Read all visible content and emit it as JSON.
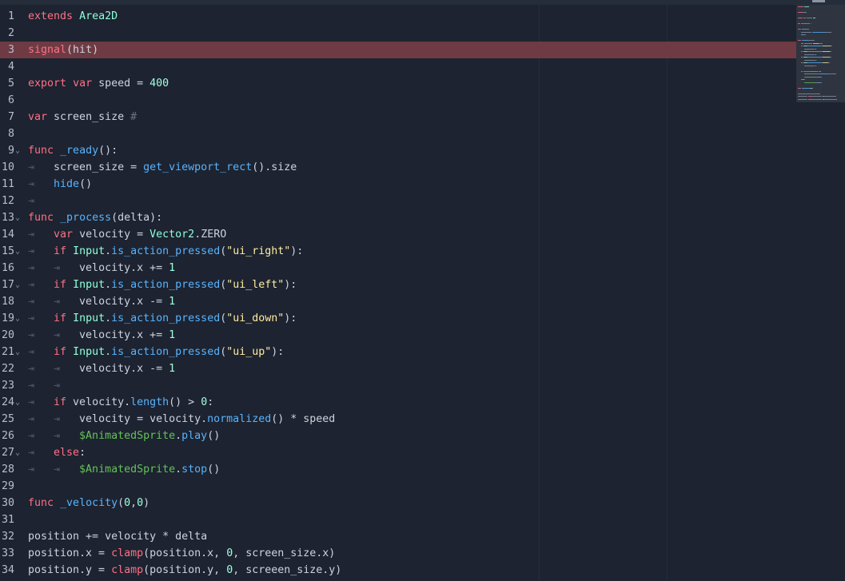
{
  "editor": {
    "theme": {
      "background": "#1d2330",
      "highlight_line": "#6e3b44",
      "keyword": "#ff7085",
      "class": "#8effda",
      "function": "#57b3ff",
      "string": "#ffeda1",
      "number": "#a1ffe0",
      "node_path": "#63c259"
    },
    "highlighted_line": 3,
    "lines": [
      {
        "n": "1",
        "fold": false,
        "tokens": [
          {
            "c": "kw",
            "t": "extends"
          },
          {
            "c": "t",
            "t": " "
          },
          {
            "c": "cls",
            "t": "Area2D"
          }
        ]
      },
      {
        "n": "2",
        "fold": false,
        "tokens": []
      },
      {
        "n": "3",
        "fold": false,
        "hl": true,
        "tokens": [
          {
            "c": "kw",
            "t": "signal"
          },
          {
            "c": "t",
            "t": "(hit)"
          }
        ]
      },
      {
        "n": "4",
        "fold": false,
        "tokens": []
      },
      {
        "n": "5",
        "fold": false,
        "tokens": [
          {
            "c": "kw",
            "t": "export"
          },
          {
            "c": "t",
            "t": " "
          },
          {
            "c": "kw",
            "t": "var"
          },
          {
            "c": "t",
            "t": " speed = "
          },
          {
            "c": "num",
            "t": "400"
          }
        ]
      },
      {
        "n": "6",
        "fold": false,
        "tokens": []
      },
      {
        "n": "7",
        "fold": false,
        "tokens": [
          {
            "c": "kw",
            "t": "var"
          },
          {
            "c": "t",
            "t": " screen_size "
          },
          {
            "c": "cmt",
            "t": "#"
          }
        ]
      },
      {
        "n": "8",
        "fold": false,
        "tokens": []
      },
      {
        "n": "9",
        "fold": true,
        "tokens": [
          {
            "c": "kw",
            "t": "func"
          },
          {
            "c": "t",
            "t": " "
          },
          {
            "c": "fn",
            "t": "_ready"
          },
          {
            "c": "t",
            "t": "():"
          }
        ]
      },
      {
        "n": "10",
        "fold": false,
        "tokens": [
          {
            "c": "tab",
            "t": "⇥   "
          },
          {
            "c": "t",
            "t": "screen_size = "
          },
          {
            "c": "fn",
            "t": "get_viewport_rect"
          },
          {
            "c": "t",
            "t": "().size"
          }
        ]
      },
      {
        "n": "11",
        "fold": false,
        "tokens": [
          {
            "c": "tab",
            "t": "⇥   "
          },
          {
            "c": "fn",
            "t": "hide"
          },
          {
            "c": "t",
            "t": "()"
          }
        ]
      },
      {
        "n": "12",
        "fold": false,
        "tokens": [
          {
            "c": "tab",
            "t": "⇥"
          }
        ]
      },
      {
        "n": "13",
        "fold": true,
        "tokens": [
          {
            "c": "kw",
            "t": "func"
          },
          {
            "c": "t",
            "t": " "
          },
          {
            "c": "fn",
            "t": "_process"
          },
          {
            "c": "t",
            "t": "(delta):"
          }
        ]
      },
      {
        "n": "14",
        "fold": false,
        "tokens": [
          {
            "c": "tab",
            "t": "⇥   "
          },
          {
            "c": "kw",
            "t": "var"
          },
          {
            "c": "t",
            "t": " velocity = "
          },
          {
            "c": "cls",
            "t": "Vector2"
          },
          {
            "c": "t",
            "t": ".ZERO"
          }
        ]
      },
      {
        "n": "15",
        "fold": true,
        "tokens": [
          {
            "c": "tab",
            "t": "⇥   "
          },
          {
            "c": "kw",
            "t": "if"
          },
          {
            "c": "t",
            "t": " "
          },
          {
            "c": "cls",
            "t": "Input"
          },
          {
            "c": "t",
            "t": "."
          },
          {
            "c": "fn",
            "t": "is_action_pressed"
          },
          {
            "c": "t",
            "t": "("
          },
          {
            "c": "str",
            "t": "\"ui_right\""
          },
          {
            "c": "t",
            "t": "):"
          }
        ]
      },
      {
        "n": "16",
        "fold": false,
        "tokens": [
          {
            "c": "tab",
            "t": "⇥   ⇥   "
          },
          {
            "c": "t",
            "t": "velocity.x += "
          },
          {
            "c": "num",
            "t": "1"
          }
        ]
      },
      {
        "n": "17",
        "fold": true,
        "tokens": [
          {
            "c": "tab",
            "t": "⇥   "
          },
          {
            "c": "kw",
            "t": "if"
          },
          {
            "c": "t",
            "t": " "
          },
          {
            "c": "cls",
            "t": "Input"
          },
          {
            "c": "t",
            "t": "."
          },
          {
            "c": "fn",
            "t": "is_action_pressed"
          },
          {
            "c": "t",
            "t": "("
          },
          {
            "c": "str",
            "t": "\"ui_left\""
          },
          {
            "c": "t",
            "t": "):"
          }
        ]
      },
      {
        "n": "18",
        "fold": false,
        "tokens": [
          {
            "c": "tab",
            "t": "⇥   ⇥   "
          },
          {
            "c": "t",
            "t": "velocity.x -= "
          },
          {
            "c": "num",
            "t": "1"
          }
        ]
      },
      {
        "n": "19",
        "fold": true,
        "tokens": [
          {
            "c": "tab",
            "t": "⇥   "
          },
          {
            "c": "kw",
            "t": "if"
          },
          {
            "c": "t",
            "t": " "
          },
          {
            "c": "cls",
            "t": "Input"
          },
          {
            "c": "t",
            "t": "."
          },
          {
            "c": "fn",
            "t": "is_action_pressed"
          },
          {
            "c": "t",
            "t": "("
          },
          {
            "c": "str",
            "t": "\"ui_down\""
          },
          {
            "c": "t",
            "t": "):"
          }
        ]
      },
      {
        "n": "20",
        "fold": false,
        "tokens": [
          {
            "c": "tab",
            "t": "⇥   ⇥   "
          },
          {
            "c": "t",
            "t": "velocity.x += "
          },
          {
            "c": "num",
            "t": "1"
          }
        ]
      },
      {
        "n": "21",
        "fold": true,
        "tokens": [
          {
            "c": "tab",
            "t": "⇥   "
          },
          {
            "c": "kw",
            "t": "if"
          },
          {
            "c": "t",
            "t": " "
          },
          {
            "c": "cls",
            "t": "Input"
          },
          {
            "c": "t",
            "t": "."
          },
          {
            "c": "fn",
            "t": "is_action_pressed"
          },
          {
            "c": "t",
            "t": "("
          },
          {
            "c": "str",
            "t": "\"ui_up\""
          },
          {
            "c": "t",
            "t": "):"
          }
        ]
      },
      {
        "n": "22",
        "fold": false,
        "tokens": [
          {
            "c": "tab",
            "t": "⇥   ⇥   "
          },
          {
            "c": "t",
            "t": "velocity.x -= "
          },
          {
            "c": "num",
            "t": "1"
          }
        ]
      },
      {
        "n": "23",
        "fold": false,
        "tokens": [
          {
            "c": "tab",
            "t": "⇥   ⇥"
          }
        ]
      },
      {
        "n": "24",
        "fold": true,
        "tokens": [
          {
            "c": "tab",
            "t": "⇥   "
          },
          {
            "c": "kw",
            "t": "if"
          },
          {
            "c": "t",
            "t": " velocity."
          },
          {
            "c": "fn",
            "t": "length"
          },
          {
            "c": "t",
            "t": "() > "
          },
          {
            "c": "num",
            "t": "0"
          },
          {
            "c": "t",
            "t": ":"
          }
        ]
      },
      {
        "n": "25",
        "fold": false,
        "tokens": [
          {
            "c": "tab",
            "t": "⇥   ⇥   "
          },
          {
            "c": "t",
            "t": "velocity = velocity."
          },
          {
            "c": "fn",
            "t": "normalized"
          },
          {
            "c": "t",
            "t": "() * speed"
          }
        ]
      },
      {
        "n": "26",
        "fold": false,
        "tokens": [
          {
            "c": "tab",
            "t": "⇥   ⇥   "
          },
          {
            "c": "node",
            "t": "$AnimatedSprite"
          },
          {
            "c": "t",
            "t": "."
          },
          {
            "c": "fn",
            "t": "play"
          },
          {
            "c": "t",
            "t": "()"
          }
        ]
      },
      {
        "n": "27",
        "fold": true,
        "tokens": [
          {
            "c": "tab",
            "t": "⇥   "
          },
          {
            "c": "kw",
            "t": "else"
          },
          {
            "c": "t",
            "t": ":"
          }
        ]
      },
      {
        "n": "28",
        "fold": false,
        "tokens": [
          {
            "c": "tab",
            "t": "⇥   ⇥   "
          },
          {
            "c": "node",
            "t": "$AnimatedSprite"
          },
          {
            "c": "t",
            "t": "."
          },
          {
            "c": "fn",
            "t": "stop"
          },
          {
            "c": "t",
            "t": "()"
          }
        ]
      },
      {
        "n": "29",
        "fold": false,
        "tokens": []
      },
      {
        "n": "30",
        "fold": false,
        "tokens": [
          {
            "c": "kw",
            "t": "func"
          },
          {
            "c": "t",
            "t": " "
          },
          {
            "c": "fn",
            "t": "_velocity"
          },
          {
            "c": "t",
            "t": "("
          },
          {
            "c": "num",
            "t": "0"
          },
          {
            "c": "t",
            "t": ","
          },
          {
            "c": "num",
            "t": "0"
          },
          {
            "c": "t",
            "t": ")"
          }
        ]
      },
      {
        "n": "31",
        "fold": false,
        "tokens": []
      },
      {
        "n": "32",
        "fold": false,
        "tokens": [
          {
            "c": "t",
            "t": "position += velocity * delta"
          }
        ]
      },
      {
        "n": "33",
        "fold": false,
        "tokens": [
          {
            "c": "t",
            "t": "position.x = "
          },
          {
            "c": "kw",
            "t": "clamp"
          },
          {
            "c": "t",
            "t": "(position.x, "
          },
          {
            "c": "num",
            "t": "0"
          },
          {
            "c": "t",
            "t": ", screen_size.x)"
          }
        ]
      },
      {
        "n": "34",
        "fold": false,
        "tokens": [
          {
            "c": "t",
            "t": "position.y = "
          },
          {
            "c": "kw",
            "t": "clamp"
          },
          {
            "c": "t",
            "t": "(position.y, "
          },
          {
            "c": "num",
            "t": "0"
          },
          {
            "c": "t",
            "t": ", screeen_size.y)"
          }
        ]
      }
    ]
  },
  "minimap": {
    "icon": "minimap-preview"
  }
}
